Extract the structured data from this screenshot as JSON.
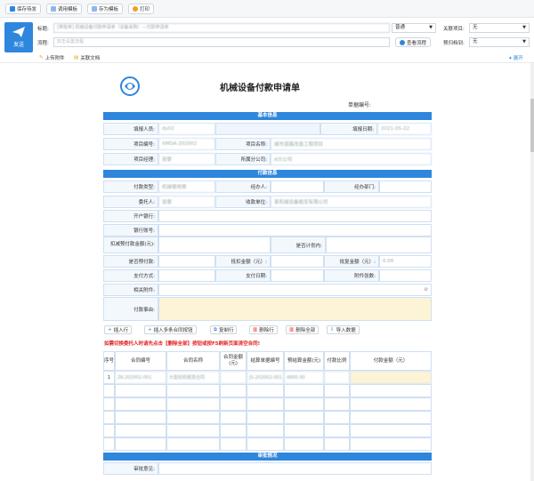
{
  "toolbar": {
    "save": "保存待发",
    "template": "调用模板",
    "save_template": "存为模板",
    "print": "打印"
  },
  "header": {
    "send": "发送",
    "title_label": "标题:",
    "title_value": "[审批单] 机械设备付款申请单（设备采购）—付款申请单",
    "flow_label": "流程:",
    "flow_placeholder": "双击设置流程",
    "priority_value": "普通",
    "view_flow": "查看流程",
    "related_project_label": "关联项目:",
    "related_project_value": "无",
    "archive_label": "预归档到:",
    "archive_value": "无",
    "upload": "上传附件",
    "related_doc": "关联文档",
    "expand": "展开"
  },
  "form": {
    "title": "机械设备付款申请单",
    "doc_no_label": "单据编号:",
    "basic_section": "基本信息",
    "applicant_label": "填报人员:",
    "applicant_value": "dy02",
    "date_label": "填报日期:",
    "date_value": "2021-05-22",
    "project_no_label": "项目编号:",
    "project_no_value": "XMDA-202002",
    "project_name_label": "项目名称:",
    "project_name_value": "城市道路改造工程项目",
    "manager_label": "项目经理:",
    "manager_value": "张黎",
    "company_label": "所属分公司:",
    "company_value": "A分公司",
    "pay_section": "付款信息",
    "pay_type_label": "付款类型:",
    "pay_type_value": "机械使用费",
    "handler_label": "经办人:",
    "dept_label": "经办部门:",
    "trustee_label": "委托人:",
    "trustee_value": "张黎",
    "receiver_label": "收款单位:",
    "receiver_value": "某机械设备租赁有限公司",
    "bank_label": "开户银行:",
    "account_label": "银行账号:",
    "deduct_label": "扣减预付款金额(元):",
    "plan_label": "是否计划内:",
    "prepay_label": "是否预付款:",
    "offset_label": "抵扣金额（元）:",
    "approved_label": "批复金额（元）:",
    "approved_value": "0.00",
    "pay_method_label": "支付方式:",
    "pay_date_label": "支付日期:",
    "attach_count_label": "附件张数:",
    "attach_label": "相关附件:",
    "reason_label": "付款事由:",
    "review_section": "审批情况",
    "opinion_label": "审批意见:"
  },
  "actions": {
    "insert": "插入行",
    "insert_multi": "插入多条合同按钮",
    "copy": "复制行",
    "delete": "删除行",
    "delete_all": "删除全部",
    "import": "导入数据",
    "warning": "如需切换委托人时请先点击【删除全部】按钮或按F5刷新页面清空合同!"
  },
  "table": {
    "headers": [
      "序号",
      "合同编号",
      "合同名称",
      "合同金额(元)",
      "结算单据编号",
      "预结算金额(元)",
      "付款比例",
      "付款金额（元）"
    ],
    "rows": [
      {
        "no": "1",
        "contract_no": "ZK-202002-001",
        "contract_name": "大型挖机租赁合同",
        "amount": "",
        "settle_no": "JS-202002-001",
        "pre_amount": "4800.00",
        "ratio": "",
        "pay": ""
      }
    ]
  },
  "colors": {
    "primary": "#2f86dd",
    "warning": "#e02020",
    "highlight": "#fdf3d6"
  }
}
